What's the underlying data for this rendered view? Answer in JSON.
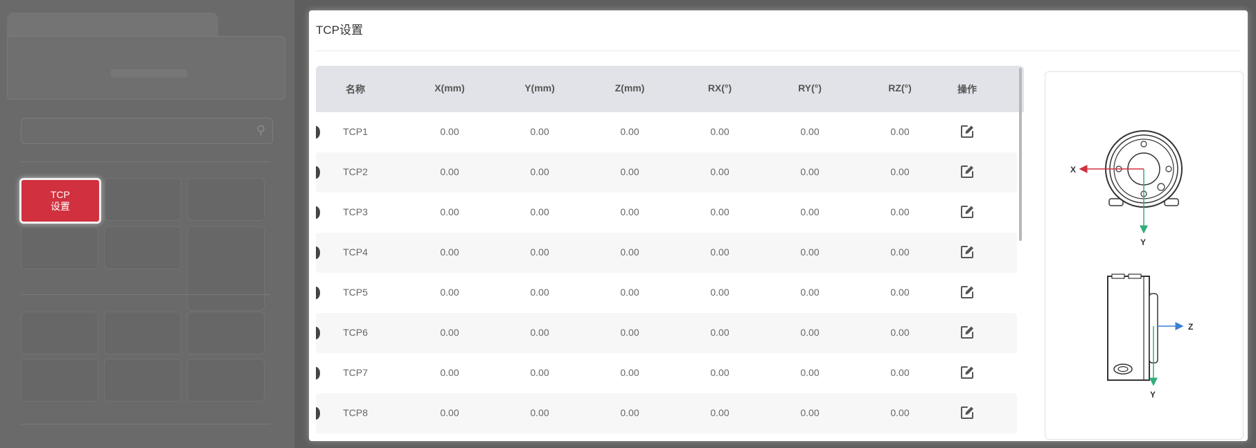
{
  "background_app": {
    "tcp_button": {
      "line1": "TCP",
      "line2": "设置"
    }
  },
  "dialog": {
    "title": "TCP设置",
    "table": {
      "headers": [
        "名称",
        "X(mm)",
        "Y(mm)",
        "Z(mm)",
        "RX(°)",
        "RY(°)",
        "RZ(°)",
        "操作"
      ],
      "rows": [
        [
          "TCP1",
          "0.00",
          "0.00",
          "0.00",
          "0.00",
          "0.00",
          "0.00"
        ],
        [
          "TCP2",
          "0.00",
          "0.00",
          "0.00",
          "0.00",
          "0.00",
          "0.00"
        ],
        [
          "TCP3",
          "0.00",
          "0.00",
          "0.00",
          "0.00",
          "0.00",
          "0.00"
        ],
        [
          "TCP4",
          "0.00",
          "0.00",
          "0.00",
          "0.00",
          "0.00",
          "0.00"
        ],
        [
          "TCP5",
          "0.00",
          "0.00",
          "0.00",
          "0.00",
          "0.00",
          "0.00"
        ],
        [
          "TCP6",
          "0.00",
          "0.00",
          "0.00",
          "0.00",
          "0.00",
          "0.00"
        ],
        [
          "TCP7",
          "0.00",
          "0.00",
          "0.00",
          "0.00",
          "0.00",
          "0.00"
        ],
        [
          "TCP8",
          "0.00",
          "0.00",
          "0.00",
          "0.00",
          "0.00",
          "0.00"
        ]
      ],
      "action_icon": "edit-icon"
    },
    "figure": {
      "top_view_axes": {
        "x": "X",
        "y": "Y"
      },
      "side_view_axes": {
        "z": "Z",
        "y": "Y"
      },
      "axis_colors": {
        "x": "#d1303f",
        "y": "#2fae7a",
        "z": "#3a7fd0"
      }
    }
  },
  "colors": {
    "accent": "#d1303f",
    "header_bg": "#e2e3e8",
    "overlay": "#5e5e5e"
  }
}
